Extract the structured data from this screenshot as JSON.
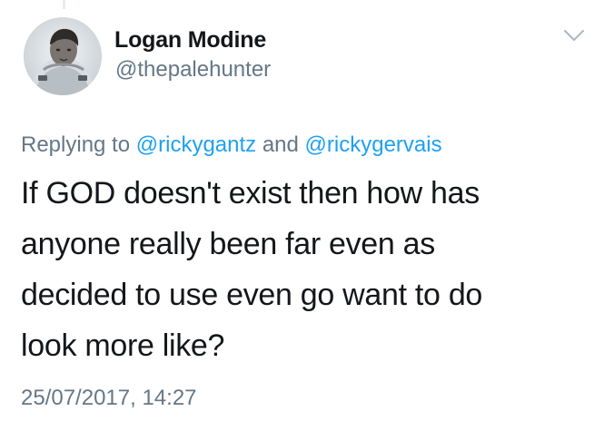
{
  "author": {
    "display_name": "Logan Modine",
    "handle": "@thepalehunter"
  },
  "reply": {
    "prefix": "Replying to ",
    "mention_1": "@rickygantz",
    "conjunction": " and ",
    "mention_2": "@rickygervais"
  },
  "tweet": {
    "lines": [
      "If GOD doesn't exist then how has",
      "anyone really been far even as",
      "decided to use even go want to do",
      "look more like?"
    ]
  },
  "timestamp": "25/07/2017, 14:27",
  "icons": {
    "menu": "chevron-down-icon",
    "avatar": "profile-photo"
  },
  "colors": {
    "text": "#14171a",
    "secondary": "#657786",
    "link": "#1da1f2",
    "background": "#ffffff"
  }
}
